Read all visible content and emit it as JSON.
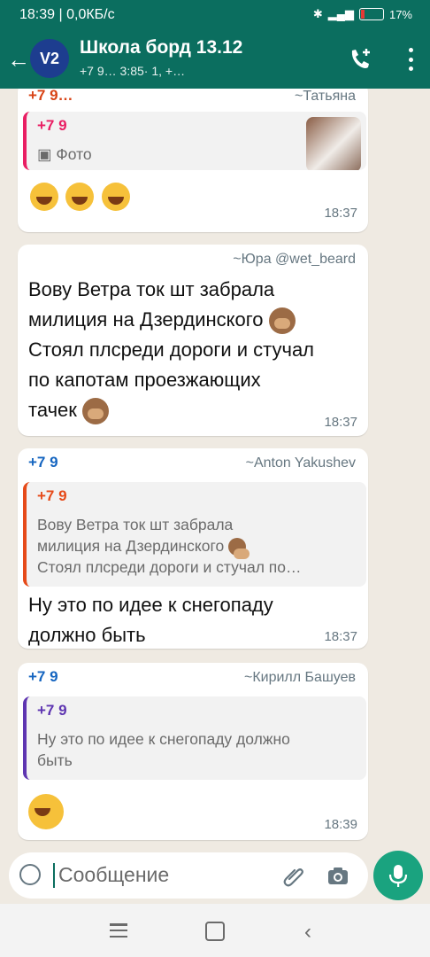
{
  "status": {
    "time": "18:39",
    "net": "0,0КБ/с",
    "battery": "17%"
  },
  "header": {
    "avatar_text": "V2",
    "title": "Школа борд 13.12",
    "subtitle": "+7 9…   3:85·      1, +…"
  },
  "messages": [
    {
      "sender_phone": "+7 9…",
      "sender_name": "~Татьяна",
      "quote_author": "+7 9",
      "quote_label": "Фото",
      "emoji_count": 3,
      "time": "18:37"
    },
    {
      "sender_name": "~Юра @wet_beard",
      "lines": [
        "Вову Ветра ток шт забрала",
        "милиция на Дзердинского",
        "Стоял плсреди дороги и стучал",
        "по капотам проезжающих",
        "тачек"
      ],
      "time": "18:37"
    },
    {
      "sender_phone": "+7 9",
      "sender_name": "~Anton Yakushev",
      "quote_author": "+7 9",
      "quote_lines": [
        "Вову Ветра ток шт забрала",
        "милиция на Дзердинского",
        "Стоял плсреди дороги и стучал по…"
      ],
      "lines": [
        "Ну это по идее к снегопаду",
        "должно быть"
      ],
      "time": "18:37"
    },
    {
      "sender_phone": "+7 9",
      "sender_name": "~Кирилл Башуев",
      "quote_author": "+7 9",
      "quote_lines": [
        "Ну это по идее к снегопаду должно",
        "быть"
      ],
      "time": "18:39"
    }
  ],
  "input": {
    "placeholder": "Сообщение"
  },
  "colors": {
    "header": "#0b6e5f",
    "mic": "#1aa37f"
  }
}
